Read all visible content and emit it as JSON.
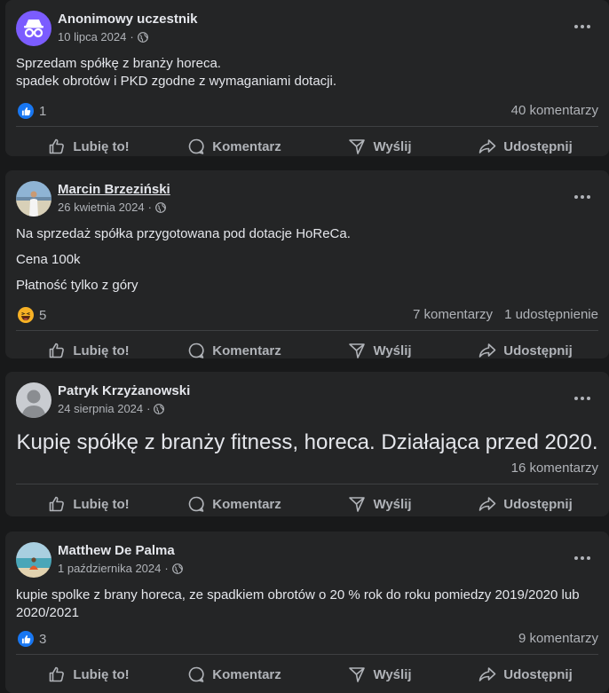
{
  "actions": {
    "like": "Lubię to!",
    "comment": "Komentarz",
    "send": "Wyślij",
    "share": "Udostępnij"
  },
  "posts": [
    {
      "author": "Anonimowy uczestnik",
      "date": "10 lipca 2024",
      "lines": [
        "Sprzedam spółkę z branży horeca.",
        "spadek obrotów i PKD zgodne z wymaganiami dotacji."
      ],
      "reaction": "like-icon",
      "reaction_count": "1",
      "comments": "40 komentarzy"
    },
    {
      "author": "Marcin Brzeziński",
      "date": "26 kwietnia 2024",
      "lines": [
        "Na sprzedaż spółka przygotowana pod dotacje HoReCa.",
        "Cena 100k",
        "Płatność tylko z góry"
      ],
      "reaction": "haha-icon",
      "reaction_count": "5",
      "comments": "7 komentarzy",
      "shares": "1 udostępnienie"
    },
    {
      "author": "Patryk Krzyżanowski",
      "date": "24 sierpnia 2024",
      "lines": [
        "Kupię spółkę z branży fitness, horeca. Działająca przed 2020."
      ],
      "comments": "16 komentarzy"
    },
    {
      "author": "Matthew De Palma",
      "date": "1 października 2024",
      "lines": [
        "kupie spolke z brany horeca, ze spadkiem obrotów o 20 % rok do roku pomiedzy 2019/2020 lub 2020/2021"
      ],
      "reaction": "like-icon",
      "reaction_count": "3",
      "comments": "9 komentarzy"
    }
  ],
  "colors": {
    "background": "#18191a",
    "card": "#242526",
    "primary_text": "#e4e6eb",
    "secondary_text": "#b0b3b8",
    "like_blue": "#1877f2",
    "anon_avatar": "#7b5cff"
  }
}
